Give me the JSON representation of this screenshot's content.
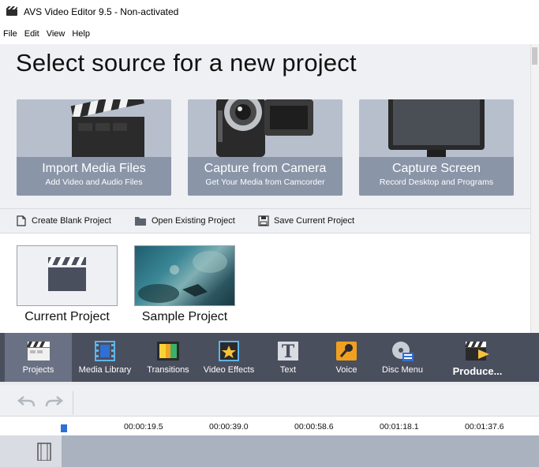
{
  "window": {
    "title": "AVS Video Editor 9.5 - Non-activated"
  },
  "menu": [
    "File",
    "Edit",
    "View",
    "Help"
  ],
  "source": {
    "heading": "Select source for a new project",
    "cards": [
      {
        "title": "Import Media Files",
        "subtitle": "Add Video and Audio Files",
        "icon": "clapperboard-icon"
      },
      {
        "title": "Capture from Camera",
        "subtitle": "Get Your Media from Camcorder",
        "icon": "camcorder-icon"
      },
      {
        "title": "Capture Screen",
        "subtitle": "Record Desktop and Programs",
        "icon": "monitor-icon"
      }
    ]
  },
  "actions": [
    {
      "label": "Create Blank Project",
      "icon": "blank-document-icon"
    },
    {
      "label": "Open Existing Project",
      "icon": "folder-icon"
    },
    {
      "label": "Save Current Project",
      "icon": "save-icon"
    }
  ],
  "recent": [
    {
      "label": "Current Project"
    },
    {
      "label": "Sample Project"
    }
  ],
  "toolbar": [
    {
      "label": "Projects",
      "icon": "clapperboard-icon",
      "active": true
    },
    {
      "label": "Media Library",
      "icon": "film-icon"
    },
    {
      "label": "Transitions",
      "icon": "transitions-icon"
    },
    {
      "label": "Video Effects",
      "icon": "star-film-icon"
    },
    {
      "label": "Text",
      "icon": "text-icon"
    },
    {
      "label": "Voice",
      "icon": "microphone-icon"
    },
    {
      "label": "Disc Menu",
      "icon": "disc-icon"
    },
    {
      "label": "Produce...",
      "icon": "produce-icon"
    }
  ],
  "timeline": {
    "ticks": [
      "00:00:19.5",
      "00:00:39.0",
      "00:00:58.6",
      "00:01:18.1",
      "00:01:37.6"
    ]
  },
  "colors": {
    "toolbar": "#4a4f5e",
    "card": "#b7bfcd",
    "accent": "#2f6fd6"
  }
}
